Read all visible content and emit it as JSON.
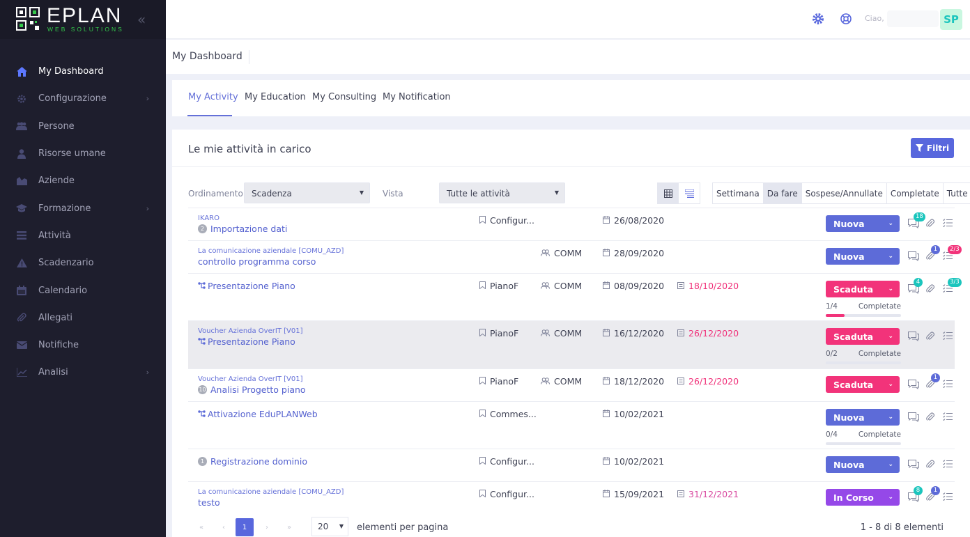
{
  "brand": {
    "name": "EPLAN",
    "sub": "WEB SOLUTIONS"
  },
  "sidebar": {
    "items": [
      {
        "label": "My Dashboard",
        "icon": "home-icon",
        "active": true
      },
      {
        "label": "Configurazione",
        "icon": "gear-icon",
        "arrow": true
      },
      {
        "label": "Persone",
        "icon": "people-icon"
      },
      {
        "label": "Risorse umane",
        "icon": "user-icon"
      },
      {
        "label": "Aziende",
        "icon": "chart-icon"
      },
      {
        "label": "Formazione",
        "icon": "graduation-cap-icon",
        "arrow": true
      },
      {
        "label": "Attività",
        "icon": "list-icon"
      },
      {
        "label": "Scadenzario",
        "icon": "warning-icon"
      },
      {
        "label": "Calendario",
        "icon": "calendar-icon"
      },
      {
        "label": "Allegati",
        "icon": "paperclip-icon"
      },
      {
        "label": "Notifiche",
        "icon": "mail-icon"
      },
      {
        "label": "Analisi",
        "icon": "analytics-icon",
        "arrow": true
      }
    ]
  },
  "topbar": {
    "greeting": "Ciao,",
    "avatar": "SP"
  },
  "subheader": {
    "title": "My Dashboard"
  },
  "tabs": [
    "My Activity",
    "My Education",
    "My Consulting",
    "My Notification"
  ],
  "card": {
    "title": "Le mie attività in carico",
    "filter_button": "Filtri"
  },
  "controls": {
    "sort_label": "Ordinamento",
    "sort_value": "Scadenza",
    "view_label": "Vista",
    "view_value": "Tutte le attività",
    "filters": [
      "Settimana",
      "Da fare",
      "Sospese/Annullate",
      "Completate",
      "Tutte"
    ]
  },
  "rows": [
    {
      "parent": "IKARO",
      "title": "Importazione dati",
      "num": "2",
      "tag": "Configur...",
      "group": "",
      "date": "26/08/2020",
      "due": "",
      "status": "Nuova",
      "msgs": "18",
      "attach": "",
      "check": ""
    },
    {
      "parent": "La comunicazione aziendale [COMU_AZD]",
      "title": "controllo programma corso",
      "num": "",
      "tag": "",
      "group": "COMM",
      "date": "28/09/2020",
      "due": "",
      "status": "Nuova",
      "msgs": "",
      "attach": "1",
      "check": "2/3"
    },
    {
      "parent": "",
      "title": "Presentazione Piano",
      "num": "",
      "tag": "PianoF",
      "group": "COMM",
      "date": "08/09/2020",
      "due": "18/10/2020",
      "status": "Scaduta",
      "progress": "1/4",
      "progress_label": "Completate",
      "progress_fraction": 0.25,
      "msgs": "4",
      "attach": "",
      "check": "3/3"
    },
    {
      "parent": "Voucher Azienda OverIT [V01]",
      "title": "Presentazione Piano",
      "num": "",
      "tag": "PianoF",
      "group": "COMM",
      "date": "16/12/2020",
      "due": "26/12/2020",
      "status": "Scaduta",
      "progress": "0/2",
      "progress_label": "Completate",
      "progress_fraction": 0,
      "msgs": "",
      "attach": "",
      "check": ""
    },
    {
      "parent": "Voucher Azienda OverIT [V01]",
      "title": "Analisi Progetto piano",
      "num": "10",
      "tag": "PianoF",
      "group": "COMM",
      "date": "18/12/2020",
      "due": "26/12/2020",
      "status": "Scaduta",
      "msgs": "",
      "attach": "1",
      "check": ""
    },
    {
      "parent": "",
      "title": "Attivazione EduPLANWeb",
      "num": "",
      "tag": "Commes...",
      "group": "",
      "date": "10/02/2021",
      "due": "",
      "status": "Nuova",
      "progress": "0/4",
      "progress_label": "Completate",
      "progress_fraction": 0,
      "msgs": "",
      "attach": "",
      "check": ""
    },
    {
      "parent": "",
      "title": "Registrazione dominio",
      "num": "1",
      "tag": "Configur...",
      "group": "",
      "date": "10/02/2021",
      "due": "",
      "status": "Nuova",
      "msgs": "",
      "attach": "",
      "check": ""
    },
    {
      "parent": "La comunicazione aziendale [COMU_AZD]",
      "title": "testo",
      "num": "",
      "tag": "Configur...",
      "group": "",
      "date": "15/09/2021",
      "due": "31/12/2021",
      "status": "In Corso",
      "msgs": "8",
      "attach": "1",
      "check": ""
    }
  ],
  "pagination": {
    "page": "1",
    "per_page": "20",
    "per_page_label": "elementi per pagina",
    "count": "1 - 8 di 8 elementi"
  }
}
